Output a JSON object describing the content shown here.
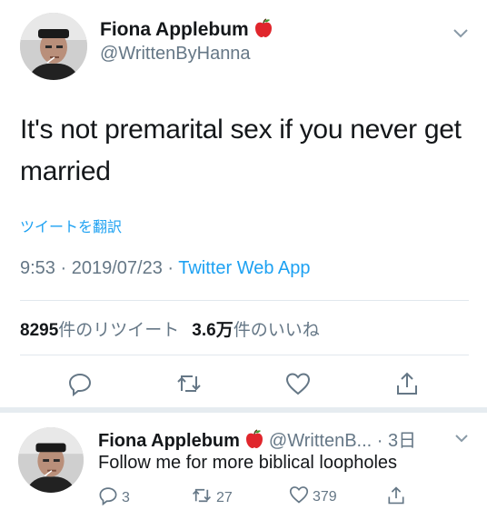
{
  "tweet": {
    "display_name": "Fiona Applebum",
    "handle": "@WrittenByHanna",
    "emoji_icon": "red-apple-icon",
    "text": "It's not premarital sex if you never get married",
    "translate_label": "ツイートを翻訳",
    "time": "9:53",
    "date": "2019/07/23",
    "source": "Twitter Web App",
    "retweet_count": "8295",
    "retweet_label": "件のリツイート",
    "like_count": "3.6万",
    "like_label": "件のいいね"
  },
  "reply": {
    "display_name": "Fiona Applebum",
    "handle": "@WrittenB...",
    "age": "3日",
    "text": "Follow me for more biblical loopholes",
    "reply_count": "3",
    "retweet_count": "27",
    "like_count": "379"
  },
  "colors": {
    "link_blue": "#1da1f2",
    "muted_gray": "#657786",
    "text_dark": "#14171a",
    "divider": "#e1e8ed"
  },
  "icons": [
    "chevron-down-icon",
    "reply-icon",
    "retweet-icon",
    "like-icon",
    "share-icon",
    "red-apple-icon"
  ]
}
